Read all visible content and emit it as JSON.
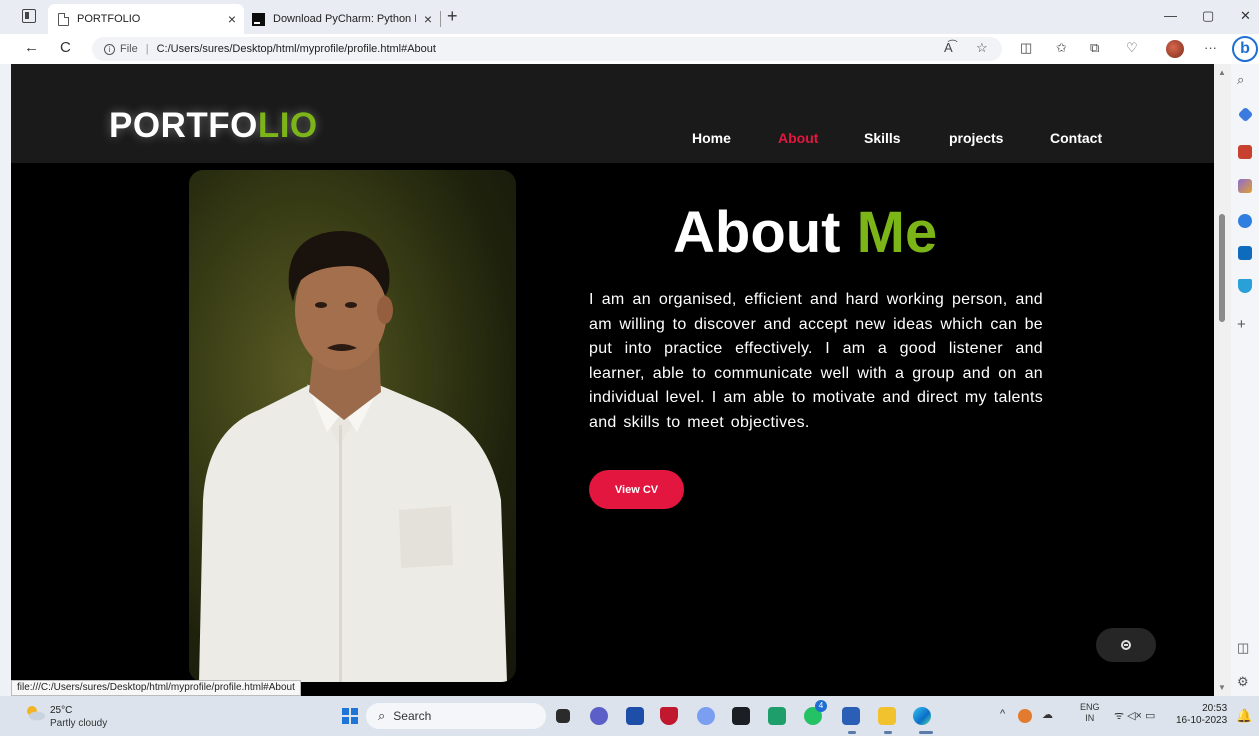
{
  "browser": {
    "tabs": [
      {
        "title": "PORTFOLIO",
        "close": "×"
      },
      {
        "title": "Download PyCharm: Python IDE",
        "close": "×"
      }
    ],
    "new_tab": "+",
    "window_controls": {
      "minimize": "—",
      "restore": "▢",
      "close": "✕"
    },
    "nav": {
      "back": "←",
      "refresh": "C"
    },
    "address": {
      "info": "i",
      "scheme": "File",
      "pipe": "|",
      "url": "C:/Users/sures/Desktop/html/myprofile/profile.html#About"
    },
    "toolbar_icons": [
      "read-aloud-icon",
      "favorite-star-icon",
      "split-screen-icon",
      "favorites-icon",
      "collections-icon",
      "browser-essentials-icon",
      "profile-avatar",
      "more-icon",
      "bing-copilot-icon"
    ],
    "toolbar_glyphs": {
      "read_aloud": "A͡",
      "star": "☆",
      "split": "◫",
      "favorites": "✩",
      "collections": "⧉",
      "essentials": "♡",
      "more": "···",
      "bing": "b"
    },
    "sidebar_icons": [
      "search-icon",
      "shopping-icon",
      "tools-icon",
      "games-icon",
      "office-icon",
      "outlook-icon",
      "telegram-icon",
      "add-icon",
      "sidebar-panel-icon",
      "settings-icon"
    ],
    "sidebar_glyphs": {
      "search": "⌕",
      "add": "+",
      "panel": "◫",
      "settings": "⚙"
    },
    "status_url": "file:///C:/Users/sures/Desktop/html/myprofile/profile.html#About"
  },
  "site": {
    "logo_main": "PORTFO",
    "logo_accent": "LIO",
    "nav": [
      "Home",
      "About",
      "Skills",
      "projects",
      "Contact"
    ],
    "active_nav": "About",
    "about_title_main": "About",
    "about_title_accent": "Me",
    "about_text": "I am an organised, efficient and hard working person, and am willing to discover and accept new ideas which can be put into practice effectively. I am a good listener and learner, able to communicate well with a group and on an individual level. I am able to motivate and direct my talents and skills to meet objectives.",
    "cv_button": "View CV",
    "colors": {
      "accent_green": "#7cb518",
      "accent_red": "#e3163f",
      "header_bg": "#1a1a1a",
      "page_bg": "#000000"
    }
  },
  "taskbar": {
    "weather_temp": "25°C",
    "weather_desc": "Partly cloudy",
    "search_placeholder": "Search",
    "search_glyph": "⌕",
    "apps": [
      "task-view-icon",
      "chat-icon",
      "store-icon",
      "mcafee-icon",
      "r-app-icon",
      "github-icon",
      "gallery-icon",
      "whatsapp-icon",
      "word-icon",
      "file-explorer-icon",
      "edge-icon"
    ],
    "whatsapp_badge": "4",
    "tray_chevron": "^",
    "tray_lang_top": "ENG",
    "tray_lang_bottom": "IN",
    "tray_glyphs": "ᯤ ◁× ▭",
    "time": "20:53",
    "date": "16-10-2023",
    "notification_glyph": "🔔"
  }
}
